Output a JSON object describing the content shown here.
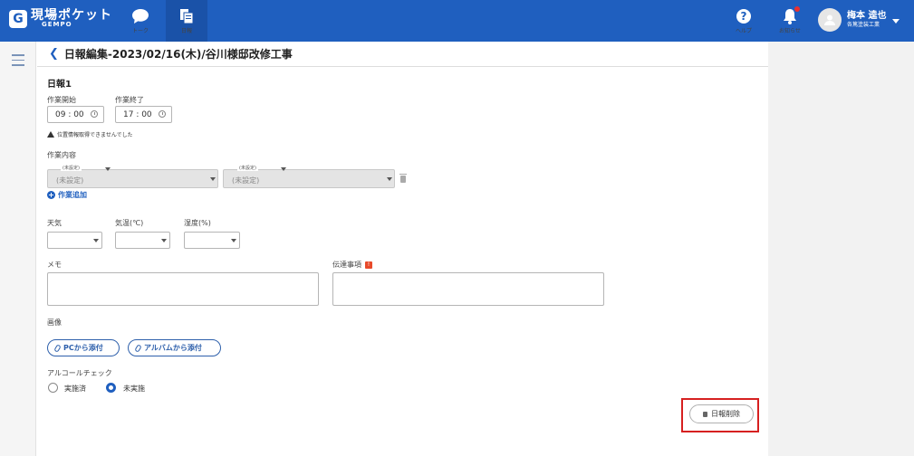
{
  "header": {
    "logo_mark": "G",
    "logo_title": "現場ポケット",
    "logo_sub": "GEMPO",
    "nav": [
      {
        "label": "トーク",
        "icon": "chat-bubble-icon"
      },
      {
        "label": "日報",
        "icon": "report-icon"
      }
    ],
    "help_label": "ヘルプ",
    "notice_label": "お知らせ",
    "user_name": "梅本 逵也",
    "user_company": "各篤塗装工業"
  },
  "page": {
    "title": "日報編集-2023/02/16(木)/谷川様邸改修工事"
  },
  "report": {
    "section_title": "日報1",
    "start_label": "作業開始",
    "end_label": "作業終了",
    "start_time": "09 : 00",
    "end_time": "17 : 00",
    "location_warning": "位置情報取得できませんでした",
    "work_label": "作業内容",
    "work_small_label_1": "(未設定)",
    "work_small_label_2": "(未設定)",
    "work_placeholder_1": "(未設定)",
    "work_placeholder_2": "(未設定)",
    "add_work": "作業追加",
    "weather_label": "天気",
    "temp_label": "気温(℃)",
    "humidity_label": "湿度(%)",
    "memo_label": "メモ",
    "notice_label": "伝達事項",
    "notice_badge": "!",
    "image_label": "画像",
    "attach_pc": "PCから添付",
    "attach_album": "アルバムから添付",
    "alcohol_label": "アルコールチェック",
    "alcohol_options": [
      "実施済",
      "未実施"
    ],
    "alcohol_selected": "未実施",
    "delete_button": "日報削除"
  },
  "colors": {
    "brand": "#1f5fbf",
    "highlight": "#d62020"
  }
}
